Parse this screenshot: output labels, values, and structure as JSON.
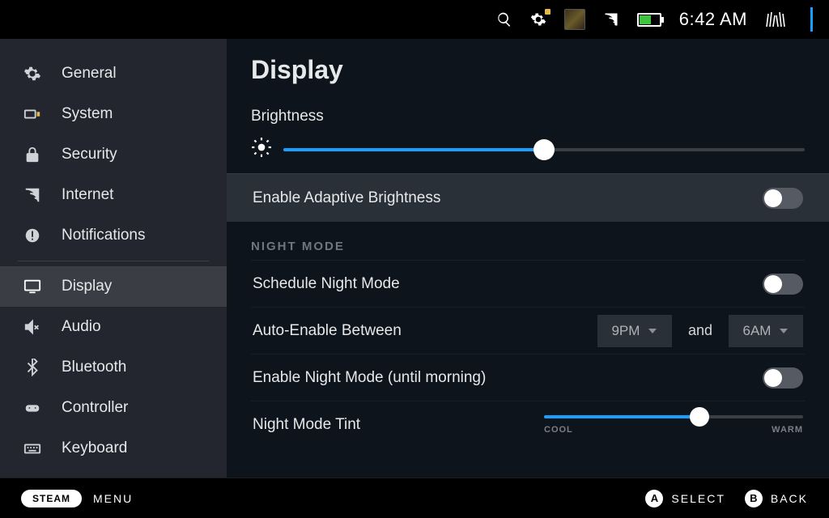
{
  "topbar": {
    "time": "6:42 AM",
    "battery_pct": 55
  },
  "sidebar": {
    "items": [
      {
        "label": "General"
      },
      {
        "label": "System"
      },
      {
        "label": "Security"
      },
      {
        "label": "Internet"
      },
      {
        "label": "Notifications"
      },
      {
        "label": "Display"
      },
      {
        "label": "Audio"
      },
      {
        "label": "Bluetooth"
      },
      {
        "label": "Controller"
      },
      {
        "label": "Keyboard"
      }
    ],
    "active_index": 5
  },
  "page": {
    "title": "Display",
    "brightness": {
      "label": "Brightness",
      "value_pct": 50
    },
    "adaptive": {
      "label": "Enable Adaptive Brightness",
      "on": false
    },
    "night_section": "NIGHT MODE",
    "schedule": {
      "label": "Schedule Night Mode",
      "on": false
    },
    "auto_enable": {
      "label": "Auto-Enable Between",
      "from": "9PM",
      "to": "6AM",
      "joiner": "and"
    },
    "until_morning": {
      "label": "Enable Night Mode (until morning)",
      "on": false
    },
    "tint": {
      "label": "Night Mode Tint",
      "value_pct": 60,
      "cool": "COOL",
      "warm": "WARM"
    }
  },
  "bottombar": {
    "steam": "STEAM",
    "menu": "MENU",
    "a": "A",
    "a_label": "SELECT",
    "b": "B",
    "b_label": "BACK"
  }
}
